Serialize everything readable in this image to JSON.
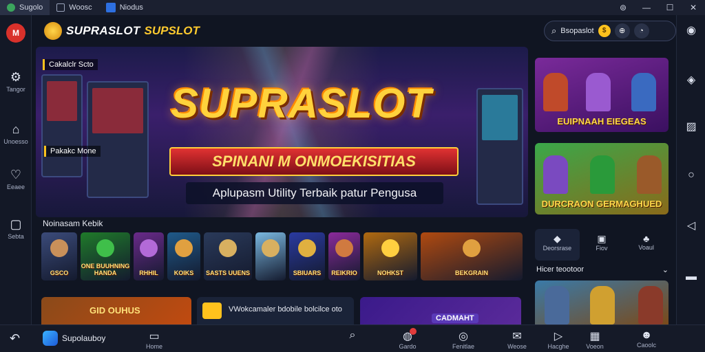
{
  "window": {
    "tabs": [
      {
        "label": "Sugolo"
      },
      {
        "label": "Woosc"
      },
      {
        "label": "Niodus"
      }
    ],
    "controls": {
      "help": "⊚",
      "minimize": "—",
      "maximize": "☐",
      "close": "✕"
    }
  },
  "left_sidebar": {
    "app_icon": "M",
    "items": [
      {
        "icon": "gear-icon",
        "glyph": "⚙",
        "label": "Tangor"
      },
      {
        "icon": "home-icon",
        "glyph": "⌂",
        "label": "Unoesso"
      },
      {
        "icon": "heart-icon",
        "glyph": "♡",
        "label": "Eeaee"
      },
      {
        "icon": "square-icon",
        "glyph": "▢",
        "label": "Sebta"
      }
    ]
  },
  "header": {
    "brand": "SUPRASLOT",
    "brand_secondary": "SUPSLOT",
    "search_text": "Bsopaslot",
    "coin": "$"
  },
  "hero": {
    "tag_top": "Cakalclr Scto",
    "tag_mid": "Pakakc Mone",
    "title": "SUPRASLOT",
    "ribbon": "SPINANI M ONMOEKISITIAS",
    "subtitle": "Aplupasm Utility Terbaik patur Pengusa"
  },
  "games_section": {
    "label": "Noinasam Kebik",
    "games": [
      {
        "label": "GSCO",
        "bg": "#3b4b7a",
        "face": "#c9905a"
      },
      {
        "label": "ONE BUUHNING HANDA",
        "bg": "#1f7a2a",
        "face": "#3fbf4a"
      },
      {
        "label": "RHHIL",
        "bg": "#6a2a8a",
        "face": "#b36ad8"
      },
      {
        "label": "KOIKS",
        "bg": "#1f5a8a",
        "face": "#e0a040"
      },
      {
        "label": "SASTS UUENS",
        "bg": "#2a3a5a",
        "face": "#d8b060"
      },
      {
        "label": "",
        "bg": "#7ab8e0",
        "face": "#d8b060"
      },
      {
        "label": "SBIUARS",
        "bg": "#2a3aa0",
        "face": "#e0b040"
      },
      {
        "label": "REIKRIO",
        "bg": "#8a2a9a",
        "face": "#d07a40"
      },
      {
        "label": "NOHKST",
        "bg": "#b06a10",
        "face": "#ffcf40"
      },
      {
        "label": "BEKGRAIN",
        "bg": "#b04a10",
        "face": "#e0a040"
      }
    ]
  },
  "bottom_cards": [
    {
      "text": "GID OUHUS",
      "bg": "#7a3a1a"
    },
    {
      "text": "VWokcamaler bdobile bolcilce oto",
      "bg": "#1a2338"
    },
    {
      "text": "CADMAHT",
      "bg": "#3a1a6a"
    }
  ],
  "right_panel": {
    "cards": [
      {
        "label": "EUIPNAAH EIEGEAS",
        "bg": "#5a1a7a"
      },
      {
        "label": "DURCRAON GERMAGHUED",
        "bg": "#2a8a3a"
      },
      {
        "label": "",
        "bg": "#3a7aa8"
      }
    ],
    "tabs": [
      {
        "icon": "location-icon",
        "glyph": "⬤",
        "label": "Deorsrase"
      },
      {
        "icon": "gamepad-icon",
        "glyph": "▣",
        "label": "Fiov"
      },
      {
        "icon": "club-icon",
        "glyph": "♣",
        "label": "Voaul"
      }
    ],
    "section_label": "Hicer teootoor",
    "section_chevron": "⌄"
  },
  "taskbar": {
    "back_glyph": "↶",
    "app_label": "Supolauboy",
    "items": [
      {
        "icon": "bag-icon",
        "glyph": "▭",
        "label": "Home"
      },
      {
        "icon": "search-icon",
        "glyph": "⌕",
        "label": ""
      },
      {
        "icon": "chat-icon",
        "glyph": "◍",
        "label": "Gardo"
      },
      {
        "icon": "globe-icon",
        "glyph": "◎",
        "label": "Fenitlae"
      },
      {
        "icon": "mail-icon",
        "glyph": "✉",
        "label": "Weose"
      },
      {
        "icon": "play-icon",
        "glyph": "▷",
        "label": "Hacghe"
      },
      {
        "icon": "calendar-icon",
        "glyph": "▦",
        "label": "Voeon"
      },
      {
        "icon": "user-icon",
        "glyph": "☻",
        "label": "Caoolc"
      }
    ]
  }
}
